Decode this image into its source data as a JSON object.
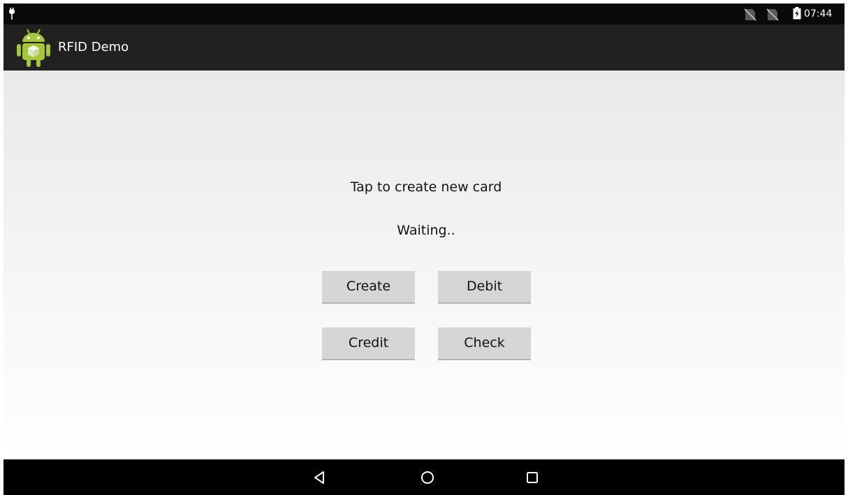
{
  "status_bar": {
    "left_icon": "usb-debug-icon",
    "sim_icons": [
      "no-sim-icon",
      "no-sim-icon"
    ],
    "battery_icon": "battery-charging-icon",
    "time": "07:44"
  },
  "action_bar": {
    "app_icon": "android-robot-icon",
    "title": "RFID Demo"
  },
  "main": {
    "prompt": "Tap to create new card",
    "status": "Waiting..",
    "buttons": {
      "create": "Create",
      "debit": "Debit",
      "credit": "Credit",
      "check": "Check"
    }
  },
  "nav_bar": {
    "back_icon": "back-triangle-icon",
    "home_icon": "home-circle-icon",
    "recents_icon": "recents-square-icon"
  },
  "colors": {
    "status_bar_bg": "#0a0a0a",
    "action_bar_bg": "#212121",
    "button_bg": "#d6d6d6",
    "nav_bar_bg": "#000000",
    "android_green": "#a4c639"
  }
}
